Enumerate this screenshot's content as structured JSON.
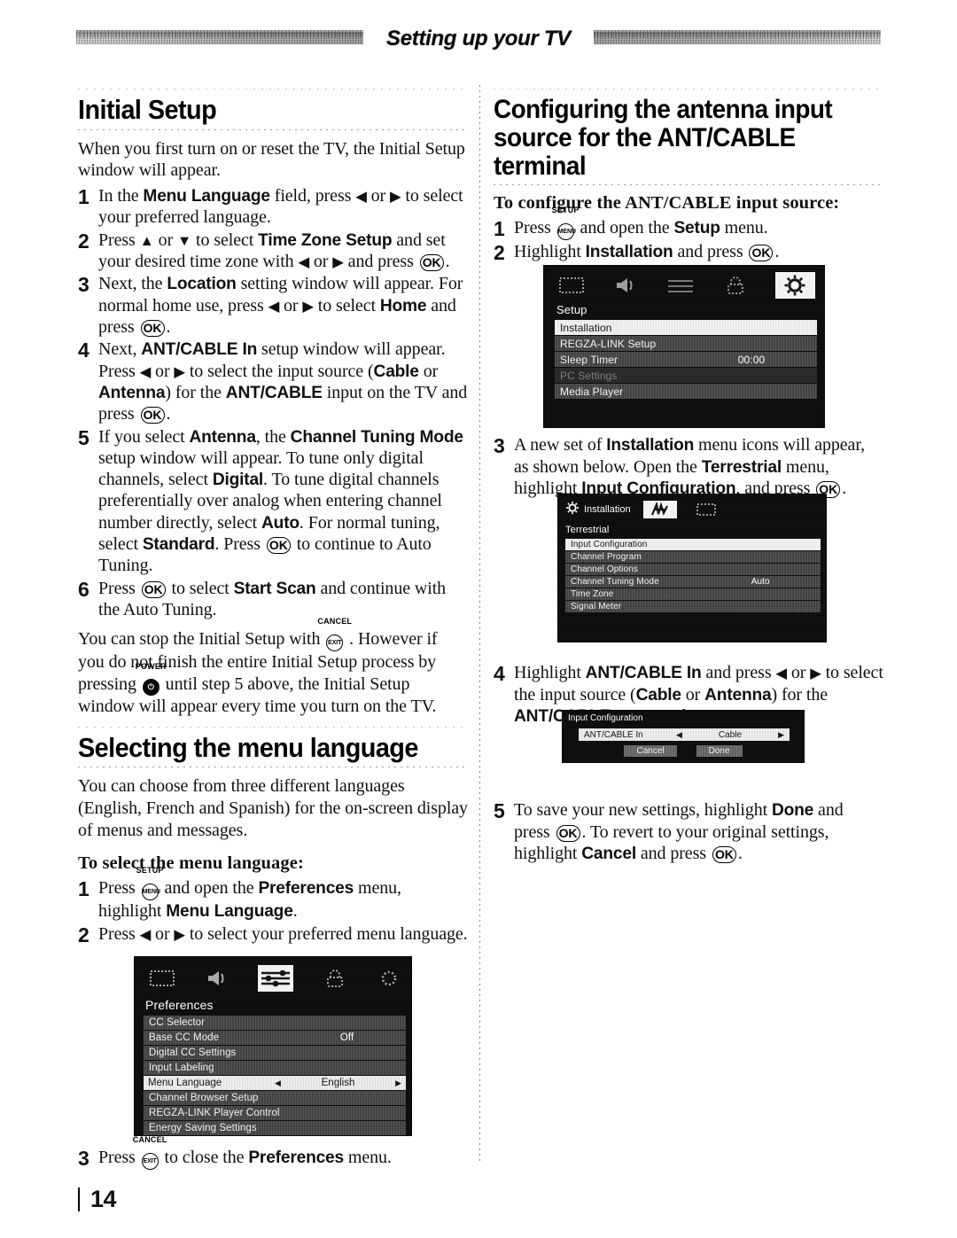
{
  "header": {
    "title": "Setting up your TV"
  },
  "folio": {
    "page_number": "14"
  },
  "left": {
    "h1_initial_setup": "Initial Setup",
    "intro": "When you first turn on or reset the TV, the Initial Setup window will appear.",
    "steps": [
      {
        "num": "1",
        "html": "In the <b>Menu Language</b> field, press <span class='arw'>◀</span> or <span class='arw'>▶</span> to select your preferred language."
      },
      {
        "num": "2",
        "html": "Press <span class='arw'>▲</span> or <span class='arw'>▼</span> to select <b>Time Zone Setup</b> and set your desired time zone with <span class='arw'>◀</span> or <span class='arw'>▶</span> and press [OK]."
      },
      {
        "num": "3",
        "html": "Next, the <b>Location</b> setting window will appear. For normal home use, press <span class='arw'>◀</span> or <span class='arw'>▶</span> to select <b>Home</b> and press [OK]."
      },
      {
        "num": "4",
        "html": "Next, <b>ANT/CABLE In</b> setup window will appear. Press <span class='arw'>◀</span> or <span class='arw'>▶</span> to select the input source (<b>Cable</b> or <b>Antenna</b>) for the <b>ANT/CABLE</b> input on the TV and press [OK]."
      },
      {
        "num": "5",
        "html": "If you select <b>Antenna</b>, the <b>Channel Tuning Mode</b> setup window will appear. To tune only digital channels, select <b>Digital</b>. To tune digital channels preferentially over analog when entering channel number directly, select <b>Auto</b>. For normal tuning, select <b>Standard</b>. Press [OK] to continue to Auto Tuning."
      },
      {
        "num": "6",
        "html": "Press [OK] to select <b>Start Scan</b> and continue with the Auto Tuning."
      }
    ],
    "note_html": "You can stop the Initial Setup with [CANCEL/EXIT] . However if you do not finish the entire Initial Setup process by pressing [POWER] until step 5 above, the Initial Setup window will appear every time you turn on the TV.",
    "h1_menu_language": "Selecting the menu language",
    "lang_intro": "You can choose from three different languages (English, French and Spanish) for the on-screen display of menus and messages.",
    "lang_subhead": "To select the menu language:",
    "lang_steps": [
      {
        "num": "1",
        "html": "Press [SETUP/MENU] and open the <b>Preferences</b> menu, highlight <b>Menu Language</b>."
      },
      {
        "num": "2",
        "html": "Press <span class='arw'>◀</span> or <span class='arw'>▶</span> to select your preferred menu language."
      },
      {
        "num": "3",
        "html": "Press [CANCEL/EXIT] to close the <b>Preferences</b> menu."
      }
    ]
  },
  "right": {
    "h1_line1": "Configuring the antenna input",
    "h1_line2": "source for the ANT/CABLE terminal",
    "subhead": "To configure the ANT/CABLE input source:",
    "steps": [
      {
        "num": "1",
        "html": "Press [SETUP/MENU] and open the <b>Setup</b> menu."
      },
      {
        "num": "2",
        "html": "Highlight <b>Installation</b> and press [OK]."
      },
      {
        "num": "3",
        "html": "A new set of <b>Installation</b> menu icons will appear, as shown below. Open the <b>Terrestrial</b> menu, highlight <b>Input Configuration</b>, and press [OK]."
      },
      {
        "num": "4",
        "html": "Highlight <b>ANT/CABLE In</b> and press <span class='arw'>◀</span> or <span class='arw'>▶</span> to select the input source (<b>Cable</b> or <b>Antenna</b>) for the <b>ANT/CABLE</b> input on the TV."
      },
      {
        "num": "5",
        "html": "To save your new settings, highlight <b>Done</b> and press [OK]. To revert to your original settings, highlight <b>Cancel</b> and press [OK]."
      }
    ]
  },
  "keys": {
    "ok_label": "OK",
    "menu_cap": "SETUP",
    "menu_label": "MENU",
    "exit_cap": "CANCEL",
    "exit_label": "EXIT",
    "power_cap": "POWER",
    "power_label": "I/\u0001"
  },
  "osd_setup": {
    "title": "Setup",
    "icons": [
      "picture-icon",
      "sound-icon",
      "preferences-icon",
      "locks-icon",
      "setup-icon"
    ],
    "selected_icon_index": 4,
    "rows": [
      {
        "label": "Installation",
        "value": "",
        "state": "highlighted"
      },
      {
        "label": "REGZA-LINK Setup",
        "value": "",
        "state": "normal"
      },
      {
        "label": "Sleep Timer",
        "value": "00:00",
        "state": "normal"
      },
      {
        "label": "PC Settings",
        "value": "",
        "state": "dimmed"
      },
      {
        "label": "Media Player",
        "value": "",
        "state": "normal"
      }
    ]
  },
  "osd_installation": {
    "header_label": "Installation",
    "title": "Terrestrial",
    "icons": [
      "terrestrial-icon",
      "input-config-icon"
    ],
    "selected_icon_index": 0,
    "rows": [
      {
        "label": "Input Configuration",
        "value": "",
        "state": "highlighted"
      },
      {
        "label": "Channel Program",
        "value": "",
        "state": "normal"
      },
      {
        "label": "Channel Options",
        "value": "",
        "state": "normal"
      },
      {
        "label": "Channel Tuning Mode",
        "value": "Auto",
        "state": "normal"
      },
      {
        "label": "Time Zone",
        "value": "",
        "state": "normal"
      },
      {
        "label": "Signal Meter",
        "value": "",
        "state": "normal"
      }
    ]
  },
  "osd_input_config": {
    "title": "Input Configuration",
    "field_label": "ANT/CABLE In",
    "field_value": "Cable",
    "left_arrow": "◀",
    "right_arrow": "▶",
    "cancel_label": "Cancel",
    "done_label": "Done"
  },
  "osd_preferences": {
    "title": "Preferences",
    "icons": [
      "picture-icon",
      "sound-icon",
      "preferences-icon",
      "locks-icon",
      "setup-icon"
    ],
    "selected_icon_index": 2,
    "rows": [
      {
        "label": "CC Selector",
        "value": "",
        "state": "normal"
      },
      {
        "label": "Base CC Mode",
        "value": "Off",
        "state": "normal"
      },
      {
        "label": "Digital CC Settings",
        "value": "",
        "state": "normal"
      },
      {
        "label": "Input Labeling",
        "value": "",
        "state": "normal"
      }
    ],
    "selected_row": {
      "label": "Menu Language",
      "value": "English",
      "left_arrow": "◀",
      "right_arrow": "▶"
    },
    "rows_after": [
      {
        "label": "Channel Browser Setup",
        "value": "",
        "state": "normal"
      },
      {
        "label": "REGZA-LINK Player Control",
        "value": "",
        "state": "normal"
      },
      {
        "label": "Energy Saving Settings",
        "value": "",
        "state": "normal"
      }
    ]
  }
}
